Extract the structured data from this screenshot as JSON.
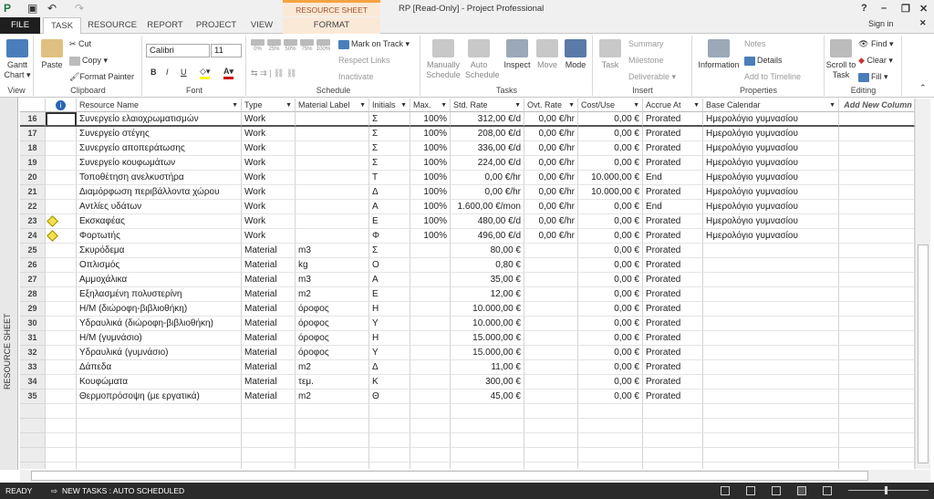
{
  "window": {
    "title": "RP [Read-Only] - Project Professional",
    "context_tab_group": "RESOURCE SHEET TOOLS",
    "help": "?",
    "minimize": "–",
    "restore": "❐",
    "close": "✕",
    "sign_in": "Sign in"
  },
  "quick_access": {
    "save": "💾",
    "undo": "↶",
    "redo": "↷"
  },
  "tabs": [
    "FILE",
    "TASK",
    "RESOURCE",
    "REPORT",
    "PROJECT",
    "VIEW",
    "FORMAT"
  ],
  "ribbon": {
    "view": {
      "label": "View",
      "gantt": "Gantt",
      "chart": "Chart ▾"
    },
    "clipboard": {
      "label": "Clipboard",
      "paste": "Paste",
      "cut": "Cut",
      "copy": "Copy ▾",
      "format_painter": "Format Painter"
    },
    "font": {
      "label": "Font",
      "font_name": "Calibri",
      "font_size": "11",
      "bold": "B",
      "italic": "I",
      "underline": "U"
    },
    "schedule": {
      "label": "Schedule",
      "mark_on_track": "Mark on Track",
      "respect_links": "Respect Links",
      "inactivate": "Inactivate",
      "pcts": [
        "0%",
        "25%",
        "50%",
        "75%",
        "100%"
      ]
    },
    "tasks": {
      "label": "Tasks",
      "manually": "Manually Schedule",
      "auto": "Auto Schedule",
      "inspect": "Inspect",
      "move": "Move",
      "mode": "Mode"
    },
    "insert": {
      "label": "Insert",
      "task": "Task",
      "summary": "Summary",
      "milestone": "Milestone",
      "deliverable": "Deliverable ▾"
    },
    "properties": {
      "label": "Properties",
      "information": "Information",
      "notes": "Notes",
      "details": "Details",
      "add_to_timeline": "Add to Timeline"
    },
    "editing": {
      "label": "Editing",
      "scroll_to_task": "Scroll to Task",
      "find": "Find",
      "clear": "Clear ▾",
      "fill": "Fill ▾"
    }
  },
  "side_label": "RESOURCE SHEET",
  "columns": [
    "",
    "Resource Name",
    "Type",
    "Material Label",
    "Initials",
    "Max.",
    "Std. Rate",
    "Ovt. Rate",
    "Cost/Use",
    "Accrue At",
    "Base Calendar",
    "Add New Column"
  ],
  "rows": [
    {
      "id": "16",
      "ind": "",
      "name": "Συνεργείο ελαιοχρωματισμών",
      "type": "Work",
      "label": "",
      "init": "Σ",
      "max": "100%",
      "std": "312,00 €/d",
      "ovt": "0,00 €/hr",
      "cost": "0,00 €",
      "accrue": "Prorated",
      "cal": "Ημερολόγιο γυμνασίου"
    },
    {
      "id": "17",
      "ind": "",
      "name": "Συνεργείο στέγης",
      "type": "Work",
      "label": "",
      "init": "Σ",
      "max": "100%",
      "std": "208,00 €/d",
      "ovt": "0,00 €/hr",
      "cost": "0,00 €",
      "accrue": "Prorated",
      "cal": "Ημερολόγιο γυμνασίου"
    },
    {
      "id": "18",
      "ind": "",
      "name": "Συνεργείο αποπεράτωσης",
      "type": "Work",
      "label": "",
      "init": "Σ",
      "max": "100%",
      "std": "336,00 €/d",
      "ovt": "0,00 €/hr",
      "cost": "0,00 €",
      "accrue": "Prorated",
      "cal": "Ημερολόγιο γυμνασίου"
    },
    {
      "id": "19",
      "ind": "",
      "name": "Συνεργείο κουφωμάτων",
      "type": "Work",
      "label": "",
      "init": "Σ",
      "max": "100%",
      "std": "224,00 €/d",
      "ovt": "0,00 €/hr",
      "cost": "0,00 €",
      "accrue": "Prorated",
      "cal": "Ημερολόγιο γυμνασίου"
    },
    {
      "id": "20",
      "ind": "",
      "name": "Τοποθέτηση ανελκυστήρα",
      "type": "Work",
      "label": "",
      "init": "Τ",
      "max": "100%",
      "std": "0,00 €/hr",
      "ovt": "0,00 €/hr",
      "cost": "10.000,00 €",
      "accrue": "End",
      "cal": "Ημερολόγιο γυμνασίου"
    },
    {
      "id": "21",
      "ind": "",
      "name": "Διαμόρφωση περιβάλλοντα χώρου",
      "type": "Work",
      "label": "",
      "init": "Δ",
      "max": "100%",
      "std": "0,00 €/hr",
      "ovt": "0,00 €/hr",
      "cost": "10.000,00 €",
      "accrue": "Prorated",
      "cal": "Ημερολόγιο γυμνασίου"
    },
    {
      "id": "22",
      "ind": "",
      "name": "Αντλίες υδάτων",
      "type": "Work",
      "label": "",
      "init": "Α",
      "max": "100%",
      "std": "1.600,00 €/mon",
      "ovt": "0,00 €/hr",
      "cost": "0,00 €",
      "accrue": "End",
      "cal": "Ημερολόγιο γυμνασίου"
    },
    {
      "id": "23",
      "ind": "warning",
      "name": "Εκσκαφέας",
      "type": "Work",
      "label": "",
      "init": "Ε",
      "max": "100%",
      "std": "480,00 €/d",
      "ovt": "0,00 €/hr",
      "cost": "0,00 €",
      "accrue": "Prorated",
      "cal": "Ημερολόγιο γυμνασίου"
    },
    {
      "id": "24",
      "ind": "warning",
      "name": "Φορτωτής",
      "type": "Work",
      "label": "",
      "init": "Φ",
      "max": "100%",
      "std": "496,00 €/d",
      "ovt": "0,00 €/hr",
      "cost": "0,00 €",
      "accrue": "Prorated",
      "cal": "Ημερολόγιο γυμνασίου"
    },
    {
      "id": "25",
      "ind": "",
      "name": "Σκυρόδεμα",
      "type": "Material",
      "label": "m3",
      "init": "Σ",
      "max": "",
      "std": "80,00 €",
      "ovt": "",
      "cost": "0,00 €",
      "accrue": "Prorated",
      "cal": ""
    },
    {
      "id": "26",
      "ind": "",
      "name": "Οπλισμός",
      "type": "Material",
      "label": "kg",
      "init": "Ο",
      "max": "",
      "std": "0,80 €",
      "ovt": "",
      "cost": "0,00 €",
      "accrue": "Prorated",
      "cal": ""
    },
    {
      "id": "27",
      "ind": "",
      "name": "Αμμοχάλικα",
      "type": "Material",
      "label": "m3",
      "init": "Α",
      "max": "",
      "std": "35,00 €",
      "ovt": "",
      "cost": "0,00 €",
      "accrue": "Prorated",
      "cal": ""
    },
    {
      "id": "28",
      "ind": "",
      "name": "Εξηλασμένη πολυστερίνη",
      "type": "Material",
      "label": "m2",
      "init": "Ε",
      "max": "",
      "std": "12,00 €",
      "ovt": "",
      "cost": "0,00 €",
      "accrue": "Prorated",
      "cal": ""
    },
    {
      "id": "29",
      "ind": "",
      "name": "Η/Μ (διώροφη-βιβλιοθήκη)",
      "type": "Material",
      "label": "όροφος",
      "init": "Η",
      "max": "",
      "std": "10.000,00 €",
      "ovt": "",
      "cost": "0,00 €",
      "accrue": "Prorated",
      "cal": ""
    },
    {
      "id": "30",
      "ind": "",
      "name": "Υδραυλικά (διώροφη-βιβλιοθήκη)",
      "type": "Material",
      "label": "όροφος",
      "init": "Υ",
      "max": "",
      "std": "10.000,00 €",
      "ovt": "",
      "cost": "0,00 €",
      "accrue": "Prorated",
      "cal": ""
    },
    {
      "id": "31",
      "ind": "",
      "name": "Η/Μ (γυμνάσιο)",
      "type": "Material",
      "label": "όροφος",
      "init": "Η",
      "max": "",
      "std": "15.000,00 €",
      "ovt": "",
      "cost": "0,00 €",
      "accrue": "Prorated",
      "cal": ""
    },
    {
      "id": "32",
      "ind": "",
      "name": "Υδραυλικά (γυμνάσιο)",
      "type": "Material",
      "label": "όροφος",
      "init": "Υ",
      "max": "",
      "std": "15.000,00 €",
      "ovt": "",
      "cost": "0,00 €",
      "accrue": "Prorated",
      "cal": ""
    },
    {
      "id": "33",
      "ind": "",
      "name": "Δάπεδα",
      "type": "Material",
      "label": "m2",
      "init": "Δ",
      "max": "",
      "std": "11,00 €",
      "ovt": "",
      "cost": "0,00 €",
      "accrue": "Prorated",
      "cal": ""
    },
    {
      "id": "34",
      "ind": "",
      "name": "Κουφώματα",
      "type": "Material",
      "label": "τεμ.",
      "init": "Κ",
      "max": "",
      "std": "300,00 €",
      "ovt": "",
      "cost": "0,00 €",
      "accrue": "Prorated",
      "cal": ""
    },
    {
      "id": "35",
      "ind": "",
      "name": "Θερμοπρόσοψη (με εργατικά)",
      "type": "Material",
      "label": "m2",
      "init": "Θ",
      "max": "",
      "std": "45,00 €",
      "ovt": "",
      "cost": "0,00 €",
      "accrue": "Prorated",
      "cal": ""
    }
  ],
  "status": {
    "ready": "READY",
    "new_tasks": "NEW TASKS : AUTO SCHEDULED"
  }
}
